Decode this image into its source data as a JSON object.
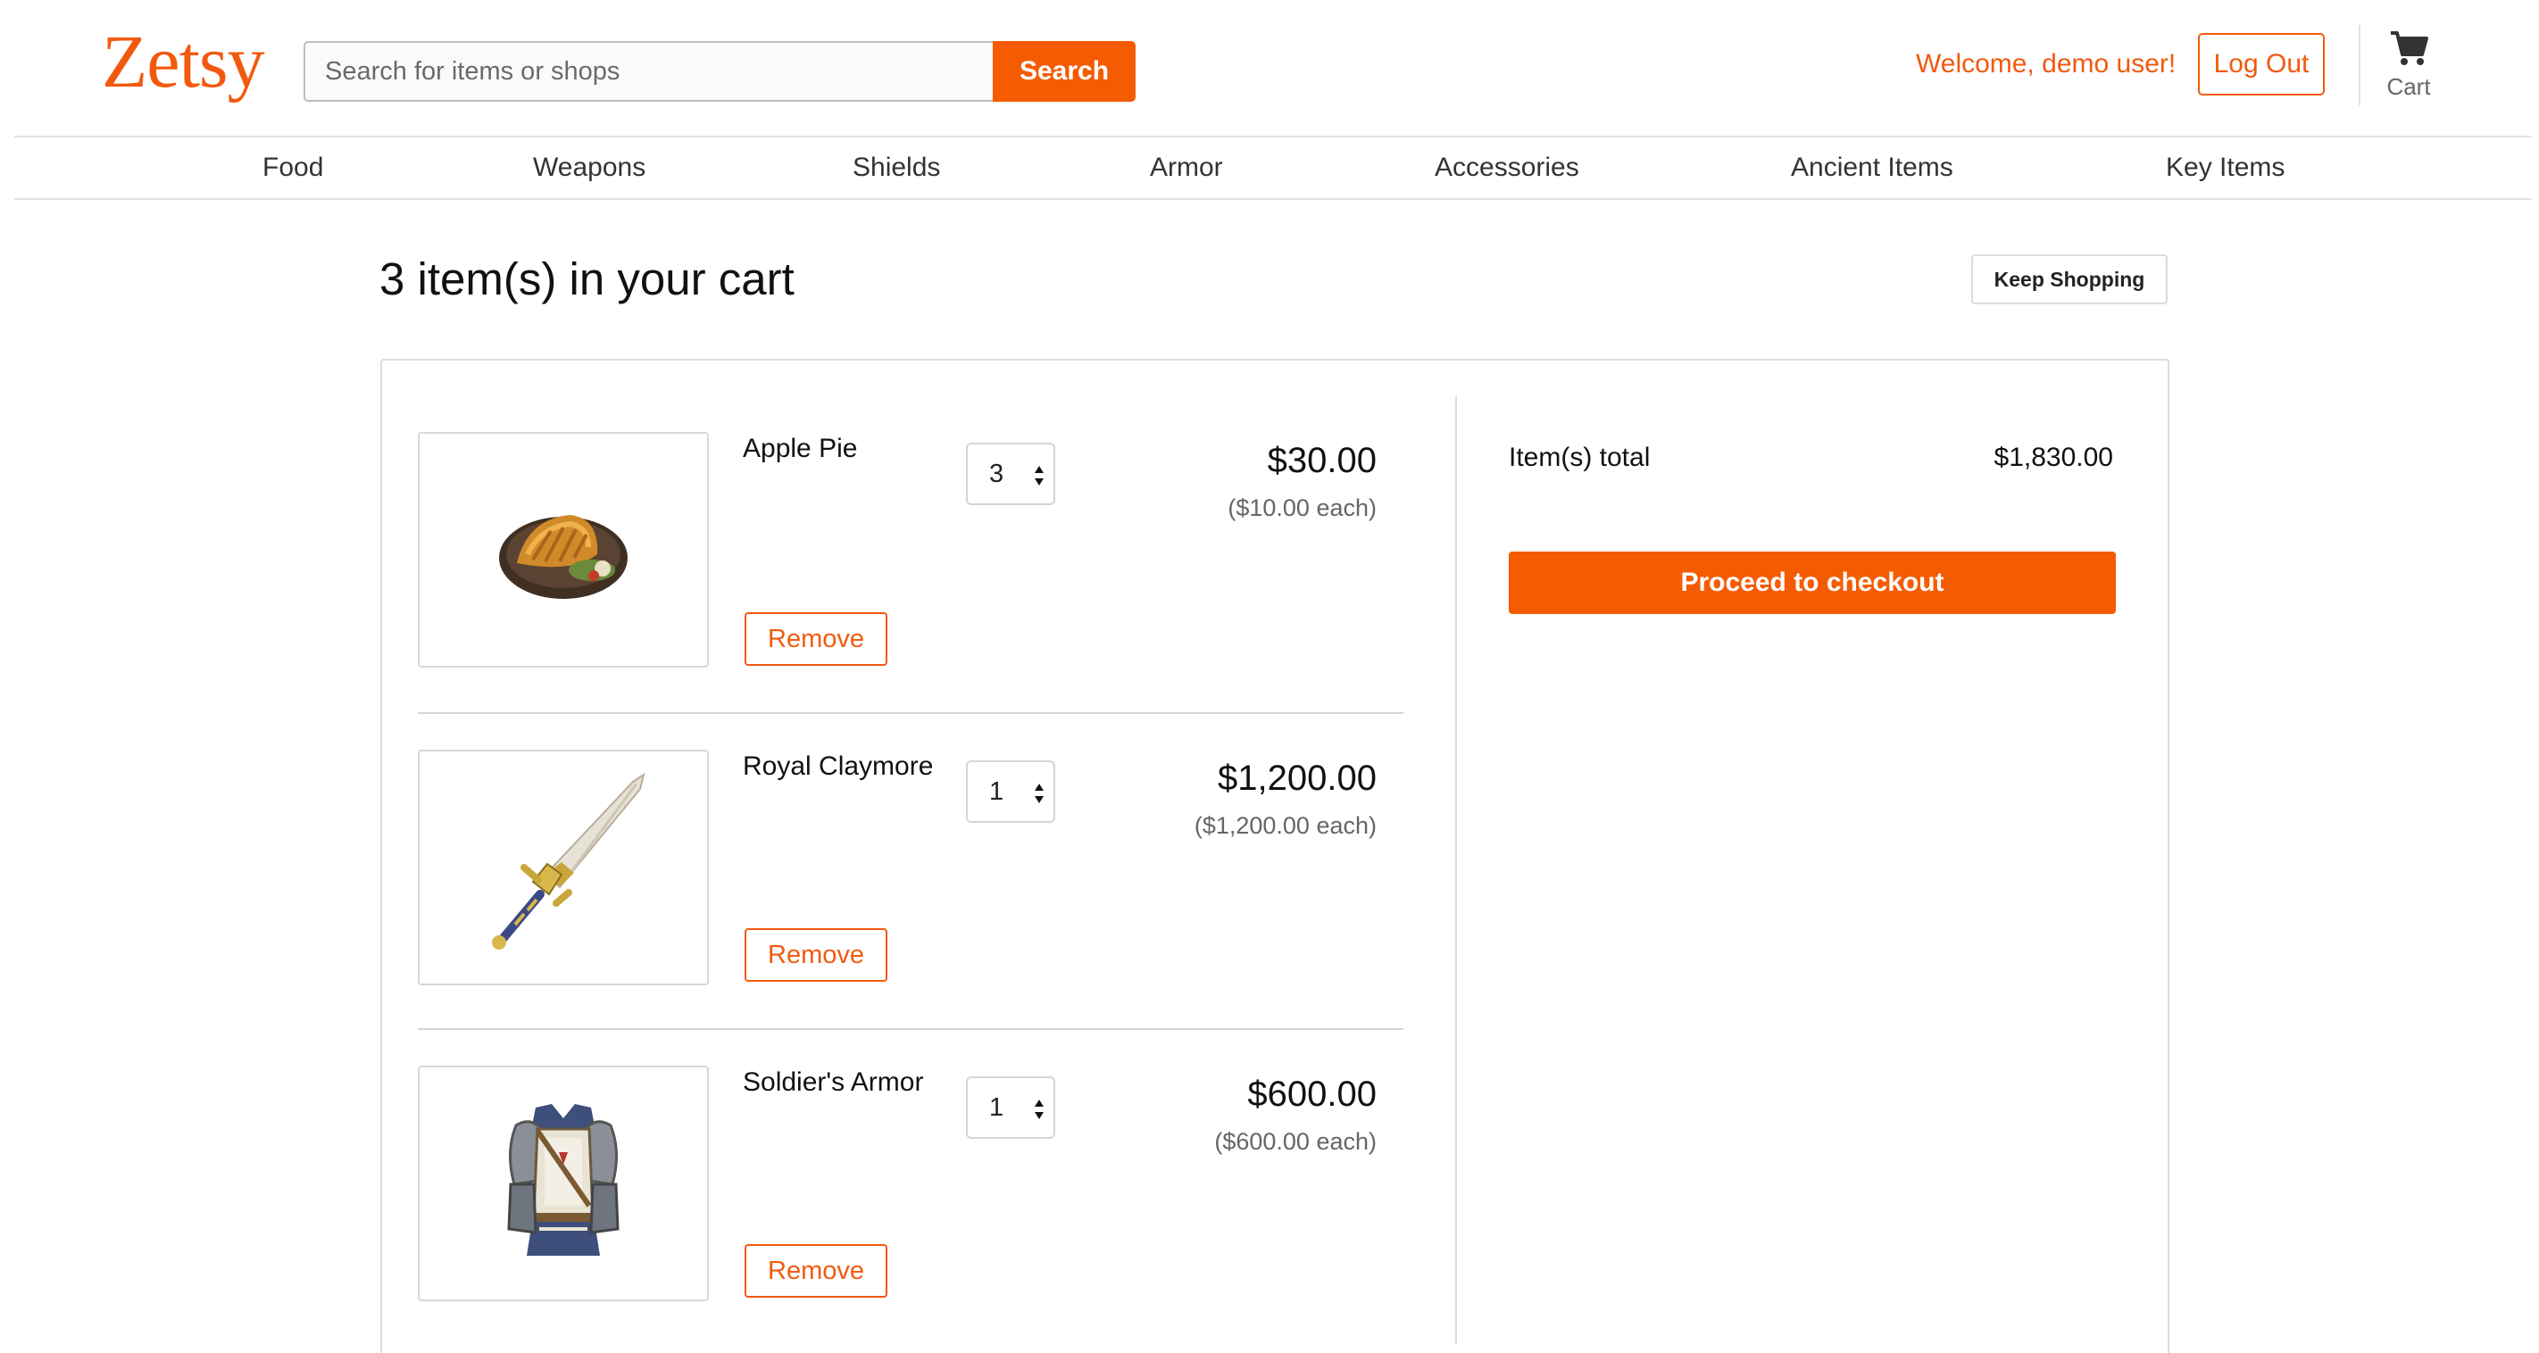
{
  "header": {
    "logo": "Zetsy",
    "search_placeholder": "Search for items or shops",
    "search_button": "Search",
    "welcome": "Welcome, demo user!",
    "logout": "Log Out",
    "cart_label": "Cart",
    "cart_icon": "cart-icon"
  },
  "nav": {
    "items": [
      "Food",
      "Weapons",
      "Shields",
      "Armor",
      "Accessories",
      "Ancient Items",
      "Key Items"
    ]
  },
  "page": {
    "title": "3 item(s) in your cart",
    "keep_shopping": "Keep Shopping"
  },
  "cart": {
    "items": [
      {
        "name": "Apple Pie",
        "qty": "3",
        "price": "$30.00",
        "each": "($10.00 each)",
        "remove": "Remove",
        "image_icon": "apple-pie-image"
      },
      {
        "name": "Royal Claymore",
        "qty": "1",
        "price": "$1,200.00",
        "each": "($1,200.00 each)",
        "remove": "Remove",
        "image_icon": "claymore-image"
      },
      {
        "name": "Soldier's Armor",
        "qty": "1",
        "price": "$600.00",
        "each": "($600.00 each)",
        "remove": "Remove",
        "image_icon": "armor-image"
      }
    ]
  },
  "summary": {
    "label": "Item(s) total",
    "value": "$1,830.00",
    "checkout": "Proceed to checkout"
  },
  "colors": {
    "accent": "#f55b01",
    "border": "#dcdcdc"
  }
}
